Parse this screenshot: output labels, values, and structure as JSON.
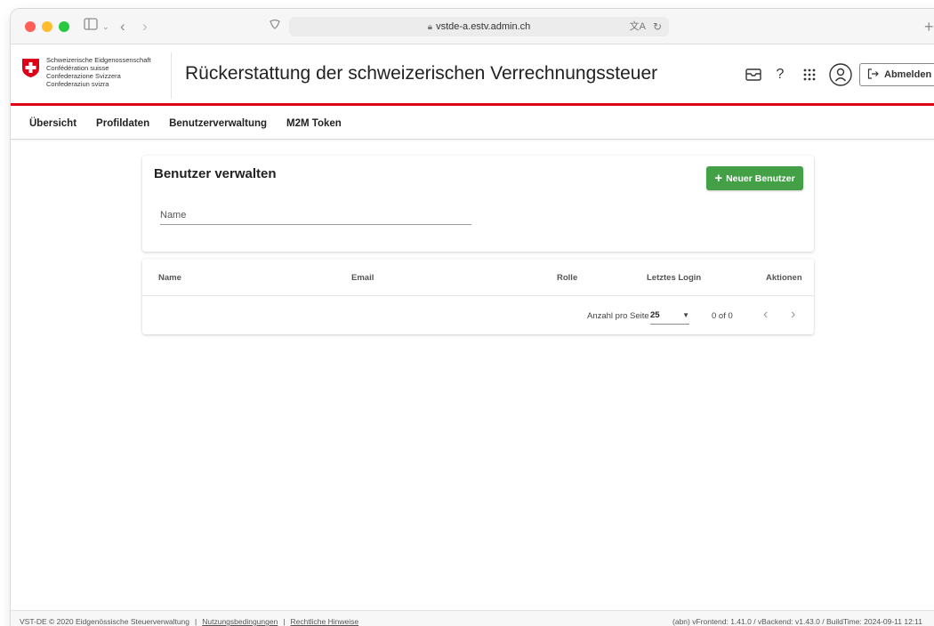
{
  "browser": {
    "url": "vstde-a.estv.admin.ch"
  },
  "header": {
    "confederation_lines": [
      "Schweizerische Eidgenossenschaft",
      "Confédération suisse",
      "Confederazione Svizzera",
      "Confederaziun svizra"
    ],
    "title": "Rückerstattung der schweizerischen Verrechnungssteuer",
    "logout_label": "Abmelden",
    "help_label": "?"
  },
  "nav": {
    "tabs": [
      {
        "label": "Übersicht"
      },
      {
        "label": "Profildaten"
      },
      {
        "label": "Benutzerverwaltung"
      },
      {
        "label": "M2M Token"
      }
    ]
  },
  "users": {
    "title": "Benutzer verwalten",
    "new_button_label": "Neuer Benutzer",
    "name_filter_placeholder": "Name",
    "table": {
      "columns": [
        "Name",
        "Email",
        "Rolle",
        "Letztes Login",
        "Aktionen"
      ],
      "rows": []
    },
    "pagination": {
      "per_page_label": "Anzahl pro Seite",
      "per_page_value": "25",
      "range_label": "0 of 0"
    }
  },
  "footer": {
    "copyright": "VST-DE © 2020 Eidgenössische Steuerverwaltung",
    "terms_link": "Nutzungsbedingungen",
    "legal_link": "Rechtliche Hinweise",
    "version_info": "(abn) vFrontend: 1.41.0 / vBackend: v1.43.0 / BuildTime: 2024-09-11 12:11"
  },
  "colors": {
    "accent_red": "#dc0018",
    "primary_green": "#43a047"
  }
}
